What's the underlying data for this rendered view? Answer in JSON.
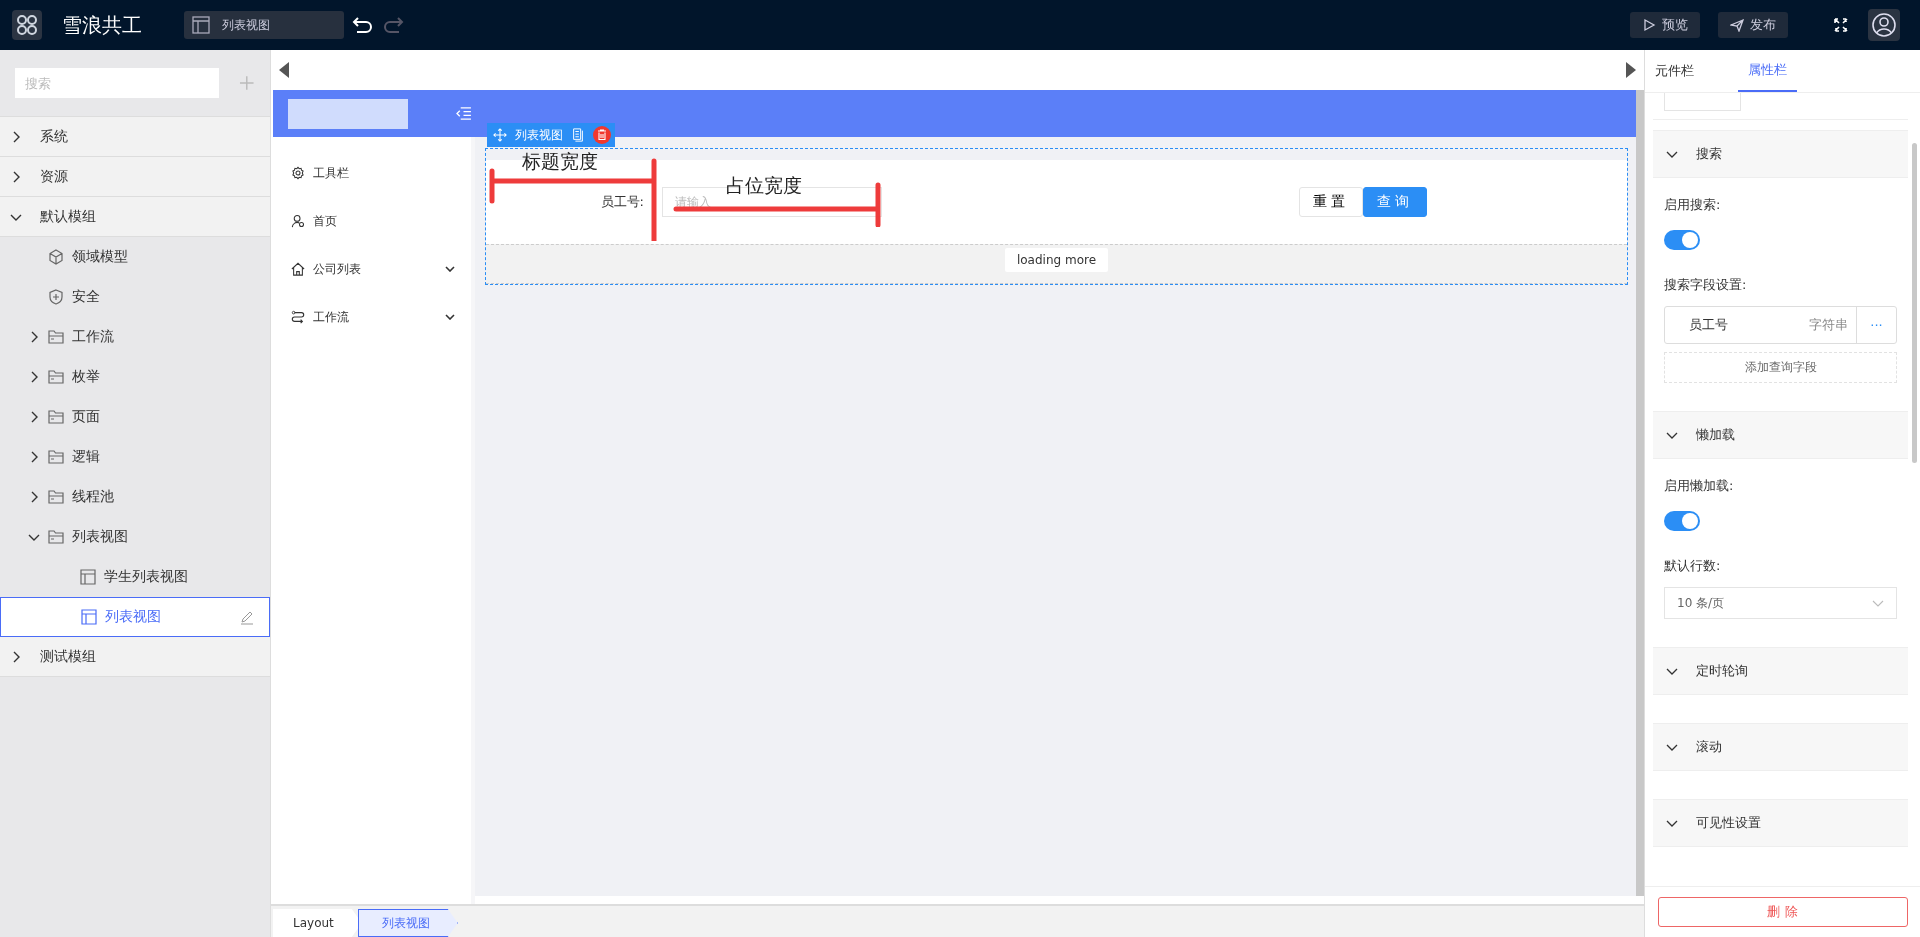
{
  "topbar": {
    "app_name": "雪浪共工",
    "current_page": "列表视图",
    "actions": [
      {
        "label": "预览",
        "kind": "preview"
      },
      {
        "label": "发布",
        "kind": "publish"
      }
    ]
  },
  "sidebar": {
    "search": {
      "placeholder": "搜索"
    },
    "tree": [
      {
        "label": "系统",
        "kind": "module",
        "expanded": false,
        "selected": false
      },
      {
        "label": "资源",
        "kind": "module",
        "expanded": false,
        "selected": false
      },
      {
        "label": "默认模组",
        "kind": "module",
        "expanded": true,
        "selected": false,
        "children": [
          {
            "label": "领域模型",
            "kind": "entity",
            "selected": false
          },
          {
            "label": "安全",
            "kind": "security",
            "selected": false
          },
          {
            "label": "工作流",
            "kind": "folder",
            "expanded": false,
            "selected": false
          },
          {
            "label": "枚举",
            "kind": "folder",
            "expanded": false,
            "selected": false
          },
          {
            "label": "页面",
            "kind": "folder",
            "expanded": false,
            "selected": false
          },
          {
            "label": "逻辑",
            "kind": "folder",
            "expanded": false,
            "selected": false
          },
          {
            "label": "线程池",
            "kind": "folder",
            "expanded": false,
            "selected": false
          },
          {
            "label": "列表视图",
            "kind": "folder",
            "expanded": true,
            "selected": false,
            "children": [
              {
                "label": "学生列表视图",
                "kind": "view",
                "selected": false
              },
              {
                "label": "列表视图",
                "kind": "view",
                "selected": true
              }
            ]
          }
        ]
      },
      {
        "label": "测试模组",
        "kind": "module",
        "expanded": false,
        "selected": false
      }
    ]
  },
  "canvas": {
    "menu": [
      {
        "label": "工具栏",
        "kind": "gear",
        "expandable": false
      },
      {
        "label": "首页",
        "kind": "user",
        "expandable": false
      },
      {
        "label": "公司列表",
        "kind": "home",
        "expandable": true
      },
      {
        "label": "工作流",
        "kind": "flow",
        "expandable": true
      }
    ],
    "component": {
      "label": "列表视图"
    },
    "search_form": {
      "field_label": "员工号:",
      "placeholder": "请输入",
      "buttons": [
        {
          "label": "重置",
          "kind": "default"
        },
        {
          "label": "查询",
          "kind": "primary"
        }
      ]
    },
    "loading": "loading more",
    "annotations": [
      {
        "label": "标题宽度",
        "kind": "label-width"
      },
      {
        "label": "占位宽度",
        "kind": "input-width"
      }
    ]
  },
  "breadcrumb": [
    {
      "label": "Layout",
      "selected": false
    },
    {
      "label": "列表视图",
      "selected": true
    }
  ],
  "panel": {
    "tabs": [
      {
        "label": "元件栏",
        "selected": false
      },
      {
        "label": "属性栏",
        "selected": true
      }
    ],
    "sections": [
      {
        "title": "搜索",
        "kind": "search",
        "toggle_label": "启用搜索:",
        "on": true,
        "fields_label": "搜索字段设置:",
        "fields": [
          {
            "name": "员工号",
            "type": "字符串"
          }
        ],
        "more": "···",
        "add_label": "添加查询字段"
      },
      {
        "title": "懒加载",
        "kind": "lazy",
        "toggle_label": "启用懒加载:",
        "on": true,
        "rows_label": "默认行数:",
        "rows_value": "10 条/页"
      },
      {
        "title": "定时轮询",
        "kind": "empty"
      },
      {
        "title": "滚动",
        "kind": "empty"
      },
      {
        "title": "可见性设置",
        "kind": "empty"
      }
    ],
    "delete_button": "删 除"
  }
}
